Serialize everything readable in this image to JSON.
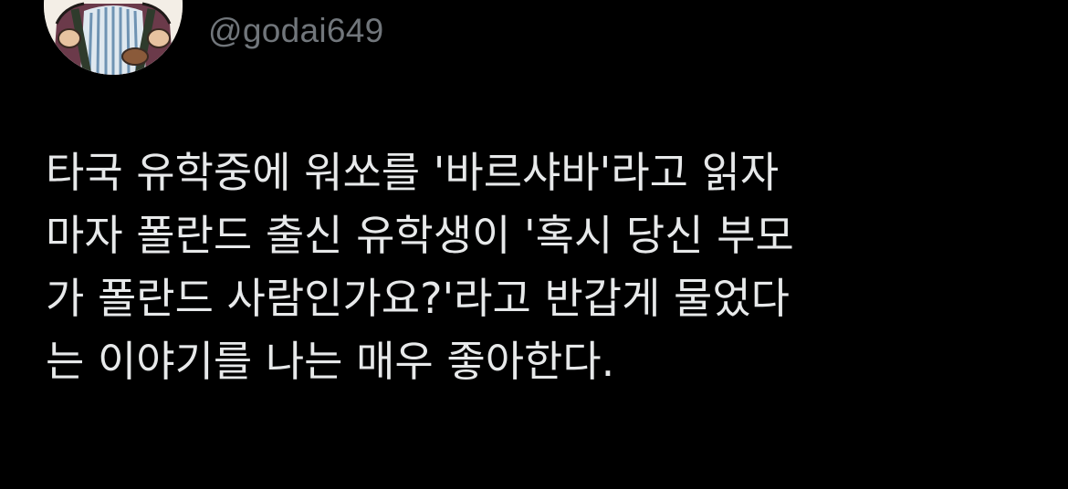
{
  "author": {
    "handle": "@godai649",
    "avatar_icon": "cartoon-character-avatar"
  },
  "tweet": {
    "text": "타국 유학중에 워쏘를 '바르샤바'라고 읽자\n마자 폴란드 출신 유학생이 '혹시 당신 부모\n가 폴란드 사람인가요?'라고 반갑게 물었다\n는 이야기를 나는 매우 좋아한다."
  },
  "colors": {
    "background": "#000000",
    "text": "#e7e9ea",
    "handle": "#71767b"
  }
}
